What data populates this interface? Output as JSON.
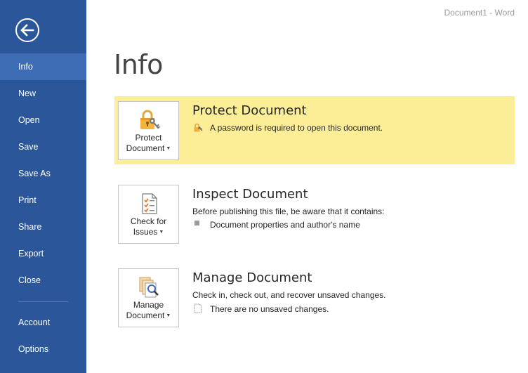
{
  "window": {
    "title": "Document1 - Word"
  },
  "sidebar": {
    "items": [
      {
        "label": "Info"
      },
      {
        "label": "New"
      },
      {
        "label": "Open"
      },
      {
        "label": "Save"
      },
      {
        "label": "Save As"
      },
      {
        "label": "Print"
      },
      {
        "label": "Share"
      },
      {
        "label": "Export"
      },
      {
        "label": "Close"
      },
      {
        "label": "Account"
      },
      {
        "label": "Options"
      }
    ],
    "active": "Info",
    "icons": {
      "back": "back-arrow-icon"
    }
  },
  "main": {
    "title": "Info",
    "sections": {
      "protect": {
        "tile_line1": "Protect",
        "tile_line2": "Document",
        "heading": "Protect Document",
        "description": "A password is required to open this document.",
        "icon": "lock-key-icon"
      },
      "inspect": {
        "tile_line1": "Check for",
        "tile_line2": "Issues",
        "heading": "Inspect Document",
        "description": "Before publishing this file, be aware that it contains:",
        "items": [
          "Document properties and author's name"
        ],
        "icon": "checklist-icon"
      },
      "manage": {
        "tile_line1": "Manage",
        "tile_line2": "Document",
        "heading": "Manage Document",
        "description": "Check in, check out, and recover unsaved changes.",
        "status": "There are no unsaved changes.",
        "icon": "document-search-icon"
      }
    }
  },
  "colors": {
    "sidebar_bg": "#2b579a",
    "sidebar_active": "#3e6db5",
    "highlight": "#fcee96"
  }
}
